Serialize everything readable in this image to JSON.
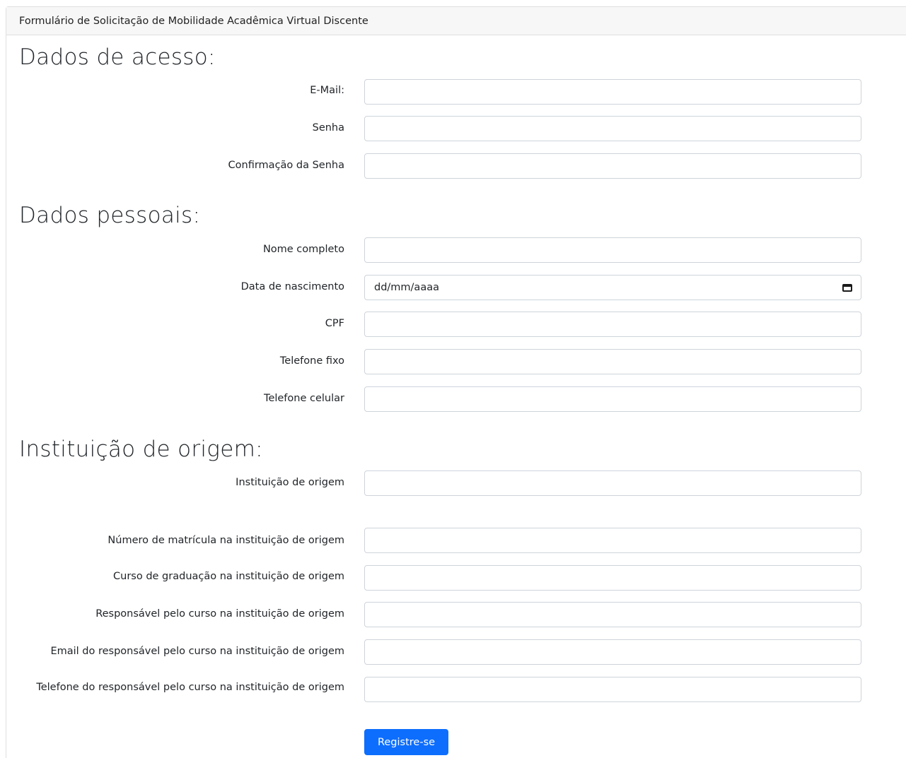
{
  "header": {
    "title": "Formulário de Solicitação de Mobilidade Acadêmica Virtual Discente"
  },
  "sections": {
    "access": "Dados de acesso:",
    "personal": "Dados pessoais:",
    "institution": "Instituição de origem:"
  },
  "fields": {
    "email": {
      "label": "E-Mail:",
      "value": ""
    },
    "senha": {
      "label": "Senha",
      "value": ""
    },
    "confirmacao_senha": {
      "label": "Confirmação da Senha",
      "value": ""
    },
    "nome_completo": {
      "label": "Nome completo",
      "value": ""
    },
    "data_nascimento": {
      "label": "Data de nascimento",
      "value": "dd/mm/aaaa",
      "icon": "calendar-icon"
    },
    "cpf": {
      "label": "CPF",
      "value": ""
    },
    "telefone_fixo": {
      "label": "Telefone fixo",
      "value": ""
    },
    "telefone_celular": {
      "label": "Telefone celular",
      "value": ""
    },
    "instituicao_origem": {
      "label": "Instituição de origem",
      "value": ""
    },
    "numero_matricula": {
      "label": "Número de matrícula na instituição de origem",
      "value": ""
    },
    "curso_graduacao": {
      "label": "Curso de graduação na instituição de origem",
      "value": ""
    },
    "responsavel_curso": {
      "label": "Responsável pelo curso na instituição de origem",
      "value": ""
    },
    "email_responsavel": {
      "label": "Email do responsável pelo curso na instituição de origem",
      "value": ""
    },
    "telefone_responsavel": {
      "label": "Telefone do responsável pelo curso na instituição de origem",
      "value": ""
    }
  },
  "submit": {
    "label": "Registre-se",
    "color": "#0d6efd"
  }
}
